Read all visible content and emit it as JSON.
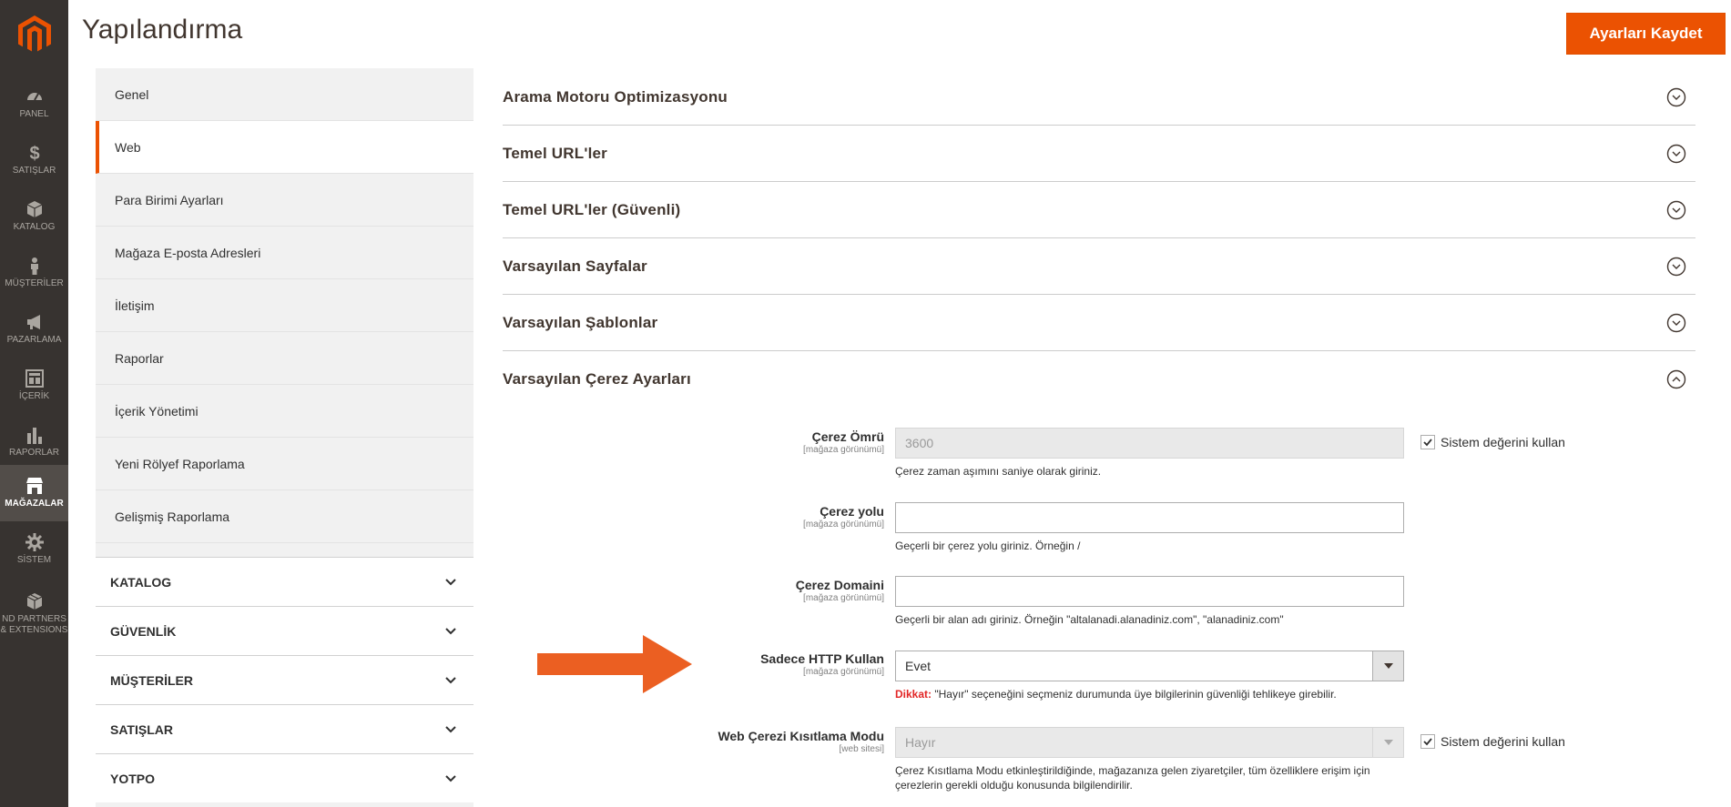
{
  "app": {
    "logo_icon": "magento-logo-icon",
    "brand_color": "#eb5202"
  },
  "nav": {
    "items": [
      {
        "label": "PANEL",
        "icon": "dashboard-icon"
      },
      {
        "label": "SATIŞLAR",
        "icon": "dollar-icon"
      },
      {
        "label": "KATALOG",
        "icon": "cube-icon"
      },
      {
        "label": "MÜŞTERİLER",
        "icon": "person-icon"
      },
      {
        "label": "PAZARLAMA",
        "icon": "megaphone-icon"
      },
      {
        "label": "İÇERİK",
        "icon": "content-icon"
      },
      {
        "label": "RAPORLAR",
        "icon": "bar-chart-icon"
      },
      {
        "label": "MAĞAZALAR",
        "icon": "store-icon"
      },
      {
        "label": "SİSTEM",
        "icon": "gear-icon"
      },
      {
        "label_line1": "ND PARTNERS",
        "label_line2": "& EXTENSIONS",
        "icon": "box-icon"
      }
    ],
    "active": "MAĞAZALAR"
  },
  "header": {
    "title": "Yapılandırma",
    "save_label": "Ayarları Kaydet"
  },
  "tabs": {
    "general_items": [
      "Genel",
      "Web",
      "Para Birimi Ayarları",
      "Mağaza E-posta Adresleri",
      "İletişim",
      "Raporlar",
      "İçerik Yönetimi",
      "Yeni Rölyef Raporlama",
      "Gelişmiş Raporlama"
    ],
    "active_item": "Web",
    "groups": [
      "KATALOG",
      "GÜVENLİK",
      "MÜŞTERİLER",
      "SATIŞLAR",
      "YOTPO"
    ]
  },
  "sections": [
    {
      "title": "Arama Motoru Optimizasyonu",
      "state": "collapsed"
    },
    {
      "title": "Temel URL'ler",
      "state": "collapsed"
    },
    {
      "title": "Temel URL'ler (Güvenli)",
      "state": "collapsed"
    },
    {
      "title": "Varsayılan Sayfalar",
      "state": "collapsed"
    },
    {
      "title": "Varsayılan Şablonlar",
      "state": "collapsed"
    },
    {
      "title": "Varsayılan Çerez Ayarları",
      "state": "expanded"
    }
  ],
  "fields": {
    "cookie_lifetime": {
      "label": "Çerez Ömrü",
      "scope": "[mağaza görünümü]",
      "value": "3600",
      "note": "Çerez zaman aşımını saniye olarak giriniz.",
      "use_system": "Sistem değerini kullan"
    },
    "cookie_path": {
      "label": "Çerez yolu",
      "scope": "[mağaza görünümü]",
      "value": "",
      "note": "Geçerli bir çerez yolu giriniz. Örneğin /"
    },
    "cookie_domain": {
      "label": "Çerez Domaini",
      "scope": "[mağaza görünümü]",
      "value": "",
      "note": "Geçerli bir alan adı giriniz. Örneğin \"altalanadi.alanadiniz.com\", \"alanadiniz.com\""
    },
    "http_only": {
      "label": "Sadece HTTP Kullan",
      "scope": "[mağaza görünümü]",
      "value": "Evet",
      "warn_label": "Dikkat:",
      "warn_text": " \"Hayır\" seçeneğini seçmeniz durumunda üye bilgilerinin güvenliği tehlikeye girebilir."
    },
    "cookie_restriction": {
      "label": "Web Çerezi Kısıtlama Modu",
      "scope": "[web sitesi]",
      "value": "Hayır",
      "note_line1": "Çerez Kısıtlama Modu etkinleştirildiğinde, mağazanıza gelen ziyaretçiler, tüm özelliklere erişim için",
      "note_line2": "çerezlerin gerekli olduğu konusunda bilgilendirilir.",
      "use_system": "Sistem değerini kullan"
    }
  },
  "annotation": {
    "arrow_color": "#eb5f22"
  }
}
